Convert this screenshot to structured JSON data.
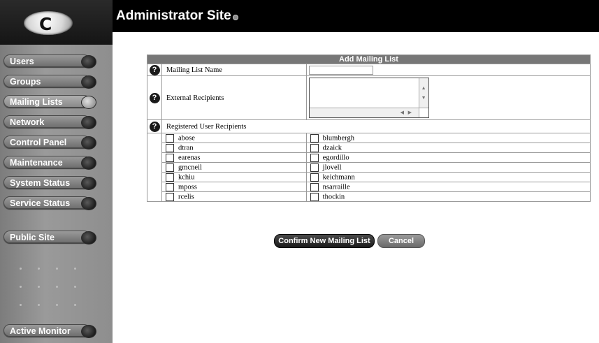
{
  "header": {
    "title": "Administrator Site",
    "logo_text": "C"
  },
  "sidebar": {
    "items": [
      {
        "label": "Users"
      },
      {
        "label": "Groups"
      },
      {
        "label": "Mailing Lists"
      },
      {
        "label": "Network"
      },
      {
        "label": "Control Panel"
      },
      {
        "label": "Maintenance"
      },
      {
        "label": "System Status"
      },
      {
        "label": "Service Status"
      }
    ],
    "public_site": "Public Site",
    "active_monitor": "Active Monitor",
    "selected": "Mailing Lists"
  },
  "form": {
    "title": "Add Mailing List",
    "name_label": "Mailing List Name",
    "name_value": "",
    "external_label": "External Recipients",
    "registered_label": "Registered User Recipients",
    "users_left": [
      "abose",
      "dtran",
      "earenas",
      "gmcneil",
      "kchiu",
      "mposs",
      "rcelis"
    ],
    "users_right": [
      "blumbergh",
      "dzaick",
      "egordillo",
      "jlovell",
      "keichmann",
      "nsarraille",
      "thockin"
    ]
  },
  "actions": {
    "confirm": "Confirm New Mailing List",
    "cancel": "Cancel"
  },
  "icons": {
    "help": "help-question-icon",
    "help_glyph": "?"
  },
  "colors": {
    "topbar": "#000000",
    "sidebar": "#8e8e8e",
    "table_header": "#777777"
  }
}
